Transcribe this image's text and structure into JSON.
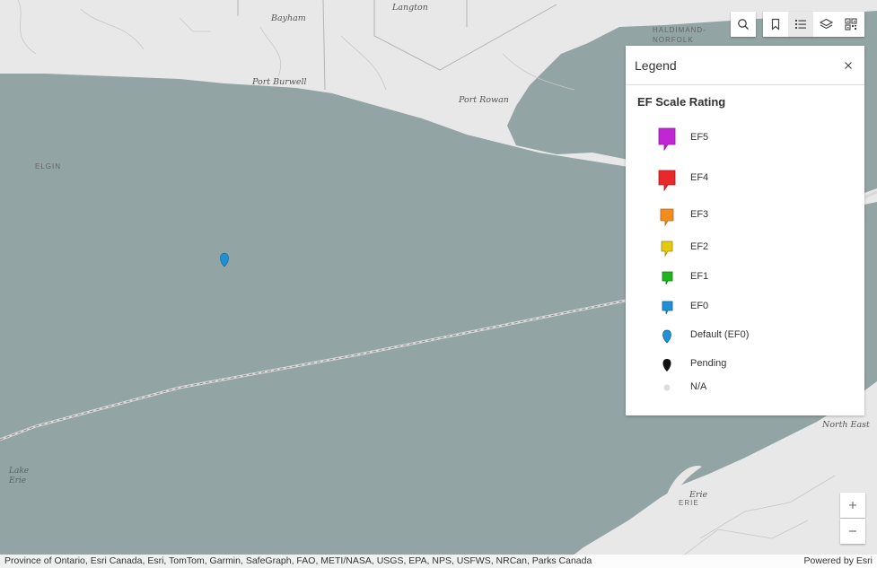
{
  "map": {
    "places": {
      "bayham": "Bayham",
      "langton": "Langton",
      "haldimand": "HALDIMAND-\nNORFOLK",
      "port_burwell": "Port Burwell",
      "port_rowan": "Port Rowan",
      "elgin": "ELGIN",
      "north_east": "North East",
      "erie_city": "Erie",
      "erie_county": "ERIE",
      "lake_erie_1": "Lake",
      "lake_erie_2": "Erie"
    },
    "colors": {
      "water": "#92a4a3",
      "land": "#e8e8e8"
    },
    "marker": {
      "icon": "default-ef0-pin-icon",
      "color": "#1e90d6"
    }
  },
  "toolbar": {
    "search": "search-icon",
    "bookmarks": "bookmark-icon",
    "legend": "legend-list-icon",
    "layers": "layers-icon",
    "qr": "qr-code-icon"
  },
  "legend": {
    "title": "Legend",
    "layer_title": "EF Scale Rating",
    "items": [
      {
        "label": "EF5",
        "color": "#c026d3"
      },
      {
        "label": "EF4",
        "color": "#e8282b"
      },
      {
        "label": "EF3",
        "color": "#f28c1e"
      },
      {
        "label": "EF2",
        "color": "#e5c90c"
      },
      {
        "label": "EF1",
        "color": "#1fb51f"
      },
      {
        "label": "EF0",
        "color": "#1e90d6"
      },
      {
        "label": "Default (EF0)",
        "color": "#1e90d6"
      },
      {
        "label": "Pending",
        "color": "#111111"
      },
      {
        "label": "N/A",
        "color": "#dddddd"
      }
    ]
  },
  "zoom": {
    "in": "+",
    "out": "−"
  },
  "attribution": {
    "sources": "Province of Ontario, Esri Canada, Esri, TomTom, Garmin, SafeGraph, FAO, METI/NASA, USGS, EPA, NPS, USFWS, NRCan, Parks Canada",
    "powered": "Powered by Esri"
  }
}
